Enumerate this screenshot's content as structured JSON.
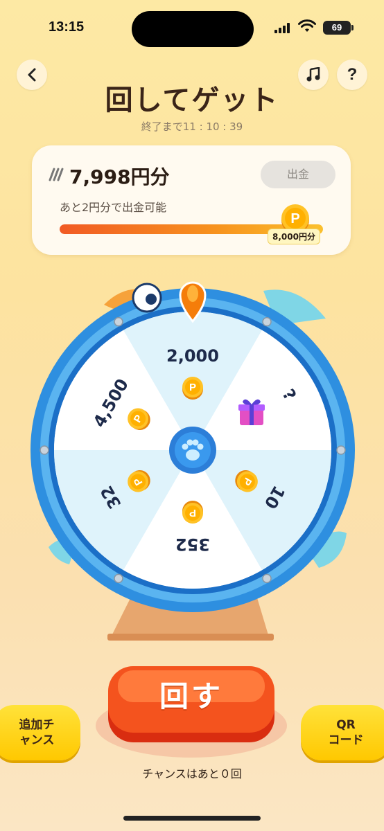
{
  "status": {
    "time": "13:15",
    "battery": "69"
  },
  "header": {
    "title": "回してゲット",
    "countdown": "終了まで11 : 10 : 39"
  },
  "card": {
    "balance": "7,998円分",
    "withdraw_label": "出金",
    "hint": "あと2円分で出金可能",
    "progress_fraction": 0.99975,
    "target_label": "8,000円分"
  },
  "wheel": {
    "segments": [
      {
        "label": "2,000",
        "kind": "coin"
      },
      {
        "label": "?",
        "kind": "gift"
      },
      {
        "label": "10",
        "kind": "coin"
      },
      {
        "label": "352",
        "kind": "coin"
      },
      {
        "label": "32",
        "kind": "coin"
      },
      {
        "label": "4,500",
        "kind": "coin"
      }
    ],
    "coin_glyph": "P"
  },
  "actions": {
    "spin_label": "回す",
    "extra_line1": "追加チ",
    "extra_line2": "ャンス",
    "qr_line1": "QR",
    "qr_line2": "コード",
    "chances": "チャンスはあと０回"
  },
  "colors": {
    "accent_orange": "#f15a24",
    "wheel_blue": "#1e7fd6",
    "spin_red": "#f0441c",
    "side_yellow": "#ffd20a"
  },
  "icons": [
    "back-arrow-icon",
    "music-note-icon",
    "help-icon",
    "coin-p-icon",
    "gift-icon",
    "paw-icon",
    "pointer-icon"
  ]
}
